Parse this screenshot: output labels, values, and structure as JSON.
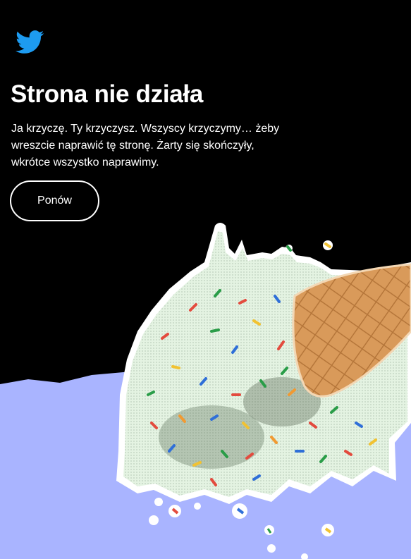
{
  "brand": {
    "logo_icon": "bird-logo-icon",
    "color": "#1D9BF0"
  },
  "error": {
    "title": "Strona nie działa",
    "description": "Ja krzyczę. Ty krzyczysz. Wszyscy krzyczymy… żeby wreszcie naprawić tę stronę. Żarty się skończyły, wkrótce wszystko naprawimy.",
    "retry_label": "Ponów"
  },
  "illustration": {
    "icon": "melted-ice-cream-icon",
    "colors": {
      "background_top": "#000000",
      "floor": "#A9B4FF",
      "ice_cream": "#E2F3E2",
      "cone": "#D89A57"
    }
  }
}
